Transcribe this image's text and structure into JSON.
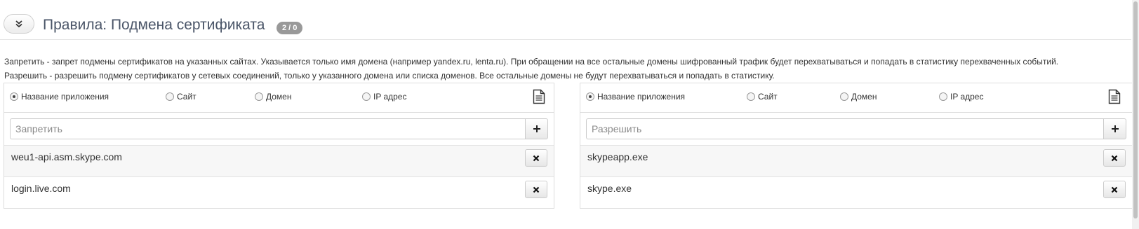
{
  "header": {
    "title": "Правила: Подмена сертификата",
    "badge": "2 / 0",
    "collapse_icon": "chevron-double-down-icon"
  },
  "description": {
    "line1": "Запретить - запрет подмены сертификатов на указанных сайтах. Указывается только имя домена (например yandex.ru, lenta.ru). При обращении на все остальные домены шифрованный трафик будет перехватываться и попадать в статистику перехваченных событий.",
    "line2": "Разрешить - разрешить подмену сертификатов у сетевых соединений, только у указанного домена или списка доменов. Все остальные домены не будут перехватываться и попадать в статистику."
  },
  "radio_options": [
    "Название приложения",
    "Сайт",
    "Домен",
    "IP адрес"
  ],
  "selected_option": "Название приложения",
  "deny_panel": {
    "placeholder": "Запретить",
    "add_label": "+",
    "remove_label": "✕",
    "items": [
      "weu1-api.asm.skype.com",
      "login.live.com"
    ]
  },
  "allow_panel": {
    "placeholder": "Разрешить",
    "add_label": "+",
    "remove_label": "✕",
    "items": [
      "skypeapp.exe",
      "skype.exe"
    ]
  },
  "icons": {
    "export": "document-icon",
    "add": "plus-icon",
    "remove": "close-icon"
  }
}
